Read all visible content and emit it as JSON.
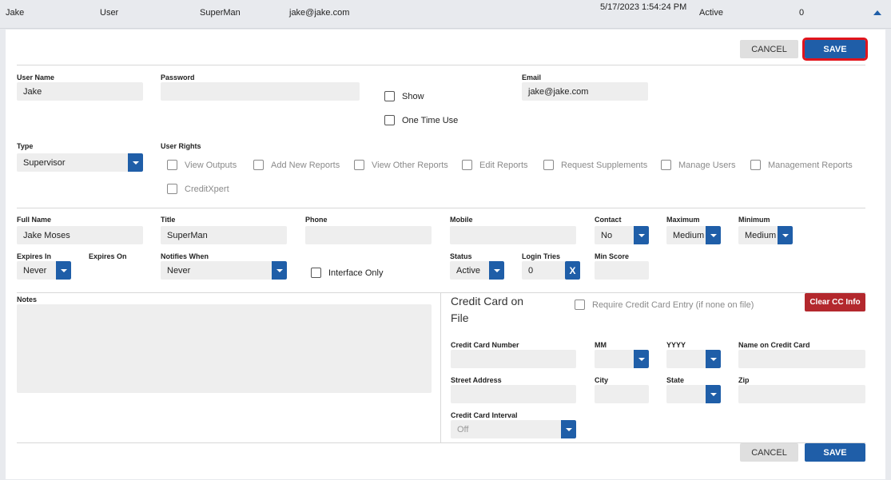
{
  "summary_row": {
    "name": "Jake",
    "type": "User",
    "title": "SuperMan",
    "email": "jake@jake.com",
    "date": "5/17/2023 1:54:24 PM",
    "status": "Active",
    "count": "0",
    "collapse_icon": "chevron-up-icon"
  },
  "actions": {
    "cancel_label": "CANCEL",
    "save_label": "SAVE",
    "clear_cc_label": "Clear CC Info"
  },
  "account": {
    "user_name_label": "User Name",
    "user_name_value": "Jake",
    "password_label": "Password",
    "password_value": "",
    "show_label": "Show",
    "one_time_use_label": "One Time Use",
    "email_label": "Email",
    "email_value": "jake@jake.com"
  },
  "type": {
    "label": "Type",
    "value": "Supervisor"
  },
  "user_rights": {
    "label": "User Rights",
    "items": [
      "View Outputs",
      "Add New Reports",
      "View Other Reports",
      "Edit Reports",
      "Request Supplements",
      "Manage Users",
      "Management Reports",
      "CreditXpert"
    ]
  },
  "details": {
    "full_name_label": "Full Name",
    "full_name_value": "Jake Moses",
    "title_label": "Title",
    "title_value": "SuperMan",
    "phone_label": "Phone",
    "phone_value": "",
    "mobile_label": "Mobile",
    "mobile_value": "",
    "contact_label": "Contact",
    "contact_value": "No",
    "maximum_label": "Maximum",
    "maximum_value": "Medium",
    "minimum_label": "Minimum",
    "minimum_value": "Medium",
    "expires_in_label": "Expires In",
    "expires_in_value": "Never",
    "expires_on_label": "Expires On",
    "notifies_when_label": "Notifies When",
    "notifies_when_value": "Never",
    "interface_only_label": "Interface Only",
    "status_label": "Status",
    "status_value": "Active",
    "login_tries_label": "Login Tries",
    "login_tries_value": "0",
    "login_tries_clear": "X",
    "min_score_label": "Min Score",
    "min_score_value": ""
  },
  "notes": {
    "label": "Notes",
    "value": ""
  },
  "credit_card": {
    "title": "Credit Card on File",
    "require_label": "Require Credit Card Entry (if none on file)",
    "number_label": "Credit Card Number",
    "mm_label": "MM",
    "yyyy_label": "YYYY",
    "name_label": "Name on Credit Card",
    "street_label": "Street Address",
    "city_label": "City",
    "state_label": "State",
    "zip_label": "Zip",
    "interval_label": "Credit Card Interval",
    "interval_value": "Off"
  },
  "colors": {
    "primary": "#1f5ea8",
    "danger": "#b3282d",
    "highlight": "#e1141c"
  }
}
